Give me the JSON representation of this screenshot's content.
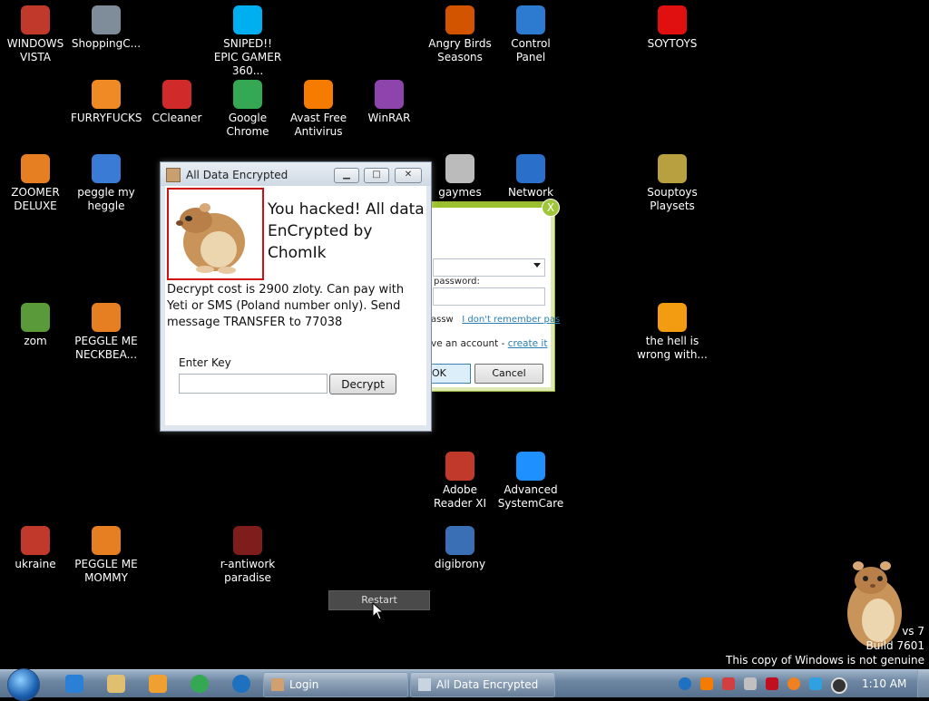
{
  "desktop_icons": [
    {
      "label": "WINDOWS VISTA",
      "icon": "ninja-icon",
      "color": "#c0392b"
    },
    {
      "label": "ShoppingC...",
      "icon": "flash-icon",
      "color": "#7f8c99"
    },
    {
      "label": "SNIPED!! EPIC GAMER 360...",
      "icon": "skype-icon",
      "color": "#00aff0"
    },
    {
      "label": "Angry Birds Seasons",
      "icon": "angry-birds-icon",
      "color": "#d35400"
    },
    {
      "label": "Control Panel",
      "icon": "control-panel-icon",
      "color": "#2d7bd1"
    },
    {
      "label": "SOYTOYS",
      "icon": "soytoys-icon",
      "color": "#e01010"
    },
    {
      "label": "FURRYFUCKS",
      "icon": "firefox-icon",
      "color": "#f08a24"
    },
    {
      "label": "CCleaner",
      "icon": "ccleaner-icon",
      "color": "#d02a2a"
    },
    {
      "label": "Google Chrome",
      "icon": "chrome-icon",
      "color": "#34a853"
    },
    {
      "label": "Avast Free Antivirus",
      "icon": "avast-icon",
      "color": "#f57c00"
    },
    {
      "label": "WinRAR",
      "icon": "winrar-icon",
      "color": "#8e44ad"
    },
    {
      "label": "ZOOMER DELUXE",
      "icon": "zoomer-icon",
      "color": "#e67e22"
    },
    {
      "label": "peggle my heggle",
      "icon": "peggle-icon",
      "color": "#3a7bd5"
    },
    {
      "label": "gaymes",
      "icon": "games-folder-icon",
      "color": "#bbbbbb"
    },
    {
      "label": "Network",
      "icon": "network-icon",
      "color": "#2a6fc9"
    },
    {
      "label": "Souptoys Playsets",
      "icon": "souptoys-icon",
      "color": "#b8a040"
    },
    {
      "label": "zom",
      "icon": "plant-icon",
      "color": "#5a9a3a"
    },
    {
      "label": "PEGGLE ME NECKBEA...",
      "icon": "peggle-icon",
      "color": "#e67e22"
    },
    {
      "label": "the hell is wrong with...",
      "icon": "uc-browser-icon",
      "color": "#f39c12"
    },
    {
      "label": "Adobe Reader XI",
      "icon": "adobe-reader-icon",
      "color": "#c0392b"
    },
    {
      "label": "Advanced SystemCare",
      "icon": "systemcare-icon",
      "color": "#1e90ff"
    },
    {
      "label": "ukraine",
      "icon": "radiation-icon",
      "color": "#c0392b"
    },
    {
      "label": "PEGGLE ME MOMMY",
      "icon": "peggle-icon",
      "color": "#e67e22"
    },
    {
      "label": "r-antiwork paradise",
      "icon": "reddit-icon",
      "color": "#7f1d1d"
    },
    {
      "label": "digibrony",
      "icon": "digibrony-icon",
      "color": "#3b6fb5"
    }
  ],
  "ransom_window": {
    "title": "All Data Encrypted",
    "headline": "You hacked! All data EnCrypted by ChomIk",
    "message": "Decrypt cost is 2900 zloty. Can pay with Yeti or SMS (Poland number only). Send message TRANSFER to 77038",
    "key_label": "Enter Key",
    "key_value": "",
    "decrypt_label": "Decrypt",
    "minimize_glyph": "▁",
    "maximize_glyph": "□",
    "close_glyph": "✕"
  },
  "login_window": {
    "close_glyph": "X",
    "password_label": "password:",
    "remember_prefix": "assw",
    "remember_link": "I don't remember pas",
    "account_prefix": "ve an account - ",
    "account_link": "create it",
    "ok_label": "OK",
    "cancel_label": "Cancel"
  },
  "restart_label": "Restart",
  "watermark": {
    "line1": "vs 7",
    "line2": "Build 7601",
    "line3": "This copy of Windows is not genuine"
  },
  "taskbar": {
    "tasks": [
      {
        "label": "Login"
      },
      {
        "label": "All Data Encrypted"
      }
    ],
    "clock": "1:10 AM"
  }
}
